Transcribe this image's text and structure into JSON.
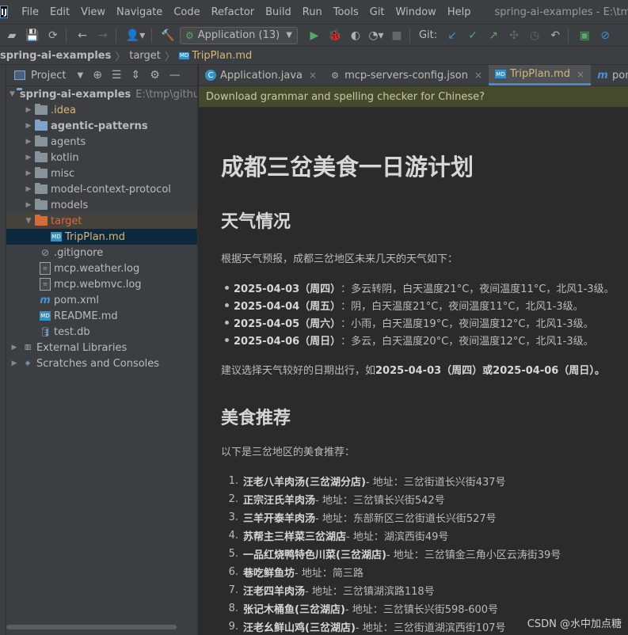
{
  "menubar": {
    "logo": "IJ",
    "items": [
      "File",
      "Edit",
      "View",
      "Navigate",
      "Code",
      "Refactor",
      "Build",
      "Run",
      "Tools",
      "Git",
      "Window",
      "Help"
    ],
    "window_title": "spring-ai-examples - E:\\tmp\\github\\sp"
  },
  "toolbar": {
    "run_config": "Application (13)",
    "git_label": "Git:"
  },
  "breadcrumb": {
    "items": [
      "spring-ai-examples",
      "target",
      "TripPlan.md"
    ]
  },
  "project_panel": {
    "title": "Project",
    "tree": [
      {
        "label": "spring-ai-examples",
        "path": "E:\\tmp\\github"
      },
      {
        "label": ".idea"
      },
      {
        "label": "agentic-patterns"
      },
      {
        "label": "agents"
      },
      {
        "label": "kotlin"
      },
      {
        "label": "misc"
      },
      {
        "label": "model-context-protocol"
      },
      {
        "label": "models"
      },
      {
        "label": "target"
      },
      {
        "label": "TripPlan.md"
      },
      {
        "label": ".gitignore"
      },
      {
        "label": "mcp.weather.log"
      },
      {
        "label": "mcp.webmvc.log"
      },
      {
        "label": "pom.xml"
      },
      {
        "label": "README.md"
      },
      {
        "label": "test.db"
      },
      {
        "label": "External Libraries"
      },
      {
        "label": "Scratches and Consoles"
      }
    ]
  },
  "editor": {
    "tabs": [
      {
        "label": "Application.java"
      },
      {
        "label": "mcp-servers-config.json"
      },
      {
        "label": "TripPlan.md"
      },
      {
        "label": "pom.xml (a"
      }
    ],
    "close_glyph": "×",
    "notice": "Download grammar and spelling checker for Chinese?"
  },
  "doc": {
    "title": "成都三岔美食一日游计划",
    "weather_heading": "天气情况",
    "weather_intro": "根据天气预报，成都三岔地区未来几天的天气如下：",
    "weather": [
      {
        "date": "2025-04-03（周四）",
        "desc": "：多云转阴，白天温度21°C，夜间温度11°C，北风1-3级。"
      },
      {
        "date": "2025-04-04（周五）",
        "desc": "：阴，白天温度21°C，夜间温度11°C，北风1-3级。"
      },
      {
        "date": "2025-04-05（周六）",
        "desc": "：小雨，白天温度19°C，夜间温度12°C，北风1-3级。"
      },
      {
        "date": "2025-04-06（周日）",
        "desc": "：多云，白天温度20°C，夜间温度12°C，北风1-3级。"
      }
    ],
    "advice_prefix": "建议选择天气较好的日期出行，如",
    "advice_bold": "2025-04-03（周四）或2025-04-06（周日）。",
    "food_heading": "美食推荐",
    "food_intro": "以下是三岔地区的美食推荐：",
    "food": [
      {
        "num": "1.",
        "name": "汪老八羊肉汤(三岔湖分店)",
        "addr": " - 地址：三岔街道长兴街437号"
      },
      {
        "num": "2.",
        "name": "正宗汪氏羊肉汤",
        "addr": " - 地址：三岔镇长兴街542号"
      },
      {
        "num": "3.",
        "name": "三羊开泰羊肉汤",
        "addr": " - 地址：东部新区三岔街道长兴街527号"
      },
      {
        "num": "4.",
        "name": "苏帮主三样菜三岔湖店",
        "addr": " - 地址：湖滨西街49号"
      },
      {
        "num": "5.",
        "name": "一品红烧鸭特色川菜(三岔湖店)",
        "addr": " - 地址：三岔镇金三角小区云涛街39号"
      },
      {
        "num": "6.",
        "name": "巷吃鲜鱼坊",
        "addr": " - 地址：简三路"
      },
      {
        "num": "7.",
        "name": "汪老四羊肉汤",
        "addr": " - 地址：三岔镇湖滨路118号"
      },
      {
        "num": "8.",
        "name": "张记木桶鱼(三岔湖店)",
        "addr": " - 地址：三岔镇长兴街598-600号"
      },
      {
        "num": "9.",
        "name": "汪老幺鲜山鸡(三岔湖店)",
        "addr": " - 地址：三岔街道湖滨西街107号"
      }
    ]
  },
  "watermark": "CSDN @水中加点糖",
  "colors": {
    "accent": "#4a88c7",
    "folder_target": "#d16d39",
    "selected_file": "#d5b778",
    "notice_bg": "#464a2d"
  }
}
